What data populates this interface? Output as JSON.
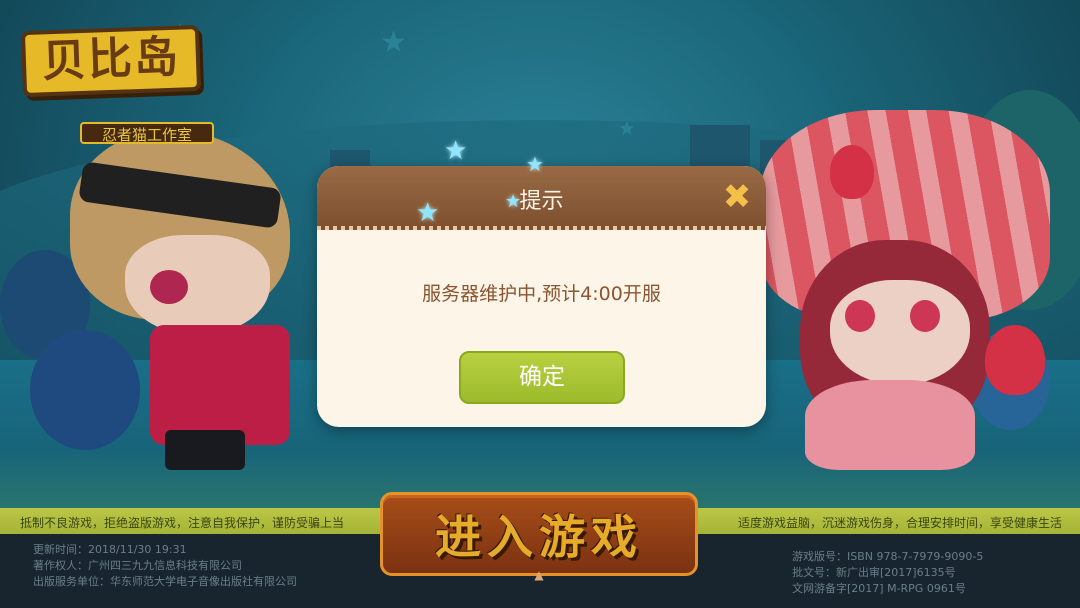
{
  "logo": {
    "title": "贝比岛",
    "studio": "忍者猫工作室"
  },
  "dialog": {
    "title": "提示",
    "close_icon": "close-icon",
    "message": "服务器维护中,预计4:00开服",
    "confirm_label": "确定"
  },
  "start_button": {
    "label": "进入游戏"
  },
  "health_notice": {
    "left": "抵制不良游戏，拒绝盗版游戏，注意自我保护，谨防受骗上当",
    "right": "适度游戏益脑，沉迷游戏伤身，合理安排时间，享受健康生活"
  },
  "footer": {
    "update_time": "更新时间：2018/11/30 19:31",
    "copyright_holder": "著作权人：广州四三九九信息科技有限公司",
    "publisher": "出版服务单位：华东师范大学电子音像出版社有限公司",
    "isbn": "游戏版号：ISBN 978-7-7979-9090-5",
    "approval": "批文号：新广出审[2017]6135号",
    "record": "文网游备字[2017] M-RPG 0961号"
  },
  "colors": {
    "header_brown": "#8a5a37",
    "confirm_green": "#aac537",
    "close_gold": "#f4c04a",
    "notice_strip": "#bccb42",
    "footer_bg": "#1a2731"
  }
}
